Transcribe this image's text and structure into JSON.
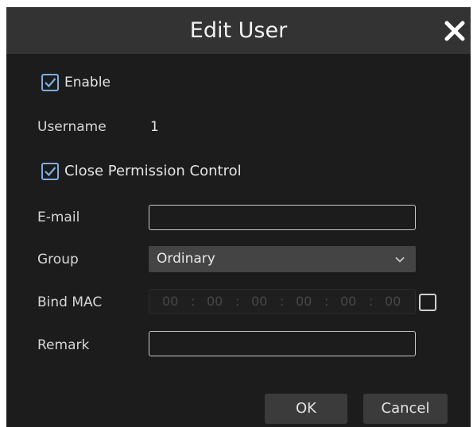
{
  "dialog": {
    "title": "Edit User",
    "close_icon": "close-icon"
  },
  "enable": {
    "label": "Enable",
    "checked": true
  },
  "username": {
    "label": "Username",
    "value": "1"
  },
  "close_permission": {
    "label": "Close Permission Control",
    "checked": true
  },
  "email": {
    "label": "E-mail",
    "value": ""
  },
  "group": {
    "label": "Group",
    "selected": "Ordinary"
  },
  "bind_mac": {
    "label": "Bind MAC",
    "octets": [
      "00",
      "00",
      "00",
      "00",
      "00",
      "00"
    ],
    "separator": ":",
    "checked": false
  },
  "remark": {
    "label": "Remark",
    "value": ""
  },
  "buttons": {
    "ok": "OK",
    "cancel": "Cancel"
  },
  "colors": {
    "dialog_bg": "#1c1c1c",
    "titlebar_bg": "#333333",
    "checkbox_accent": "#7eaee0",
    "button_bg": "#3b3b3b"
  }
}
